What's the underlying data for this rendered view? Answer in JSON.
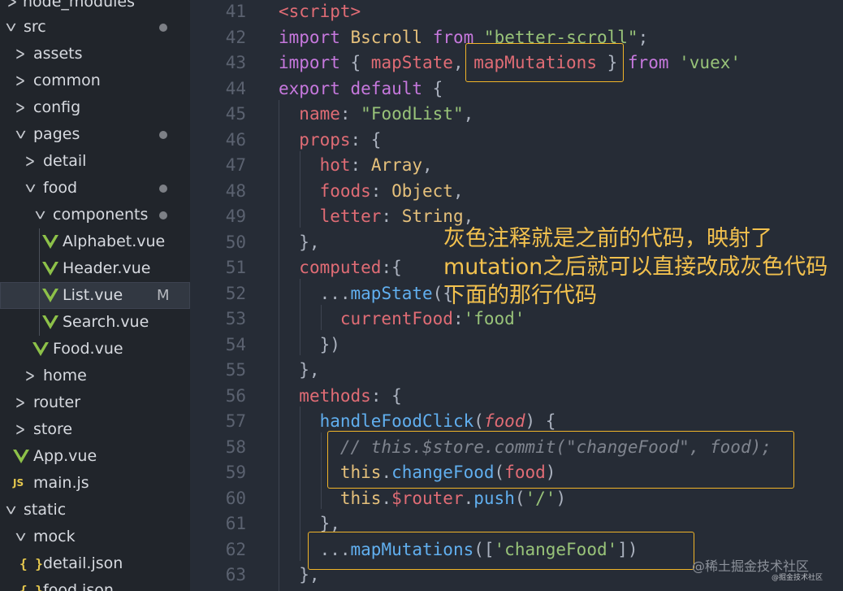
{
  "explorer": {
    "items": [
      {
        "label": "node_modules",
        "icon": "chevron-right-icon"
      },
      {
        "label": "src",
        "icon": "chevron-down-icon",
        "modified_dot": true
      },
      {
        "label": "assets",
        "icon": "chevron-right-icon"
      },
      {
        "label": "common",
        "icon": "chevron-right-icon"
      },
      {
        "label": "config",
        "icon": "chevron-right-icon"
      },
      {
        "label": "pages",
        "icon": "chevron-down-icon",
        "modified_dot": true
      },
      {
        "label": "detail",
        "icon": "chevron-right-icon"
      },
      {
        "label": "food",
        "icon": "chevron-down-icon",
        "modified_dot": true
      },
      {
        "label": "components",
        "icon": "chevron-down-icon",
        "modified_dot": true
      },
      {
        "label": "Alphabet.vue",
        "icon": "vue-icon"
      },
      {
        "label": "Header.vue",
        "icon": "vue-icon"
      },
      {
        "label": "List.vue",
        "icon": "vue-icon",
        "badge": "M",
        "selected": true
      },
      {
        "label": "Search.vue",
        "icon": "vue-icon"
      },
      {
        "label": "Food.vue",
        "icon": "vue-icon"
      },
      {
        "label": "home",
        "icon": "chevron-right-icon"
      },
      {
        "label": "router",
        "icon": "chevron-right-icon"
      },
      {
        "label": "store",
        "icon": "chevron-right-icon"
      },
      {
        "label": "App.vue",
        "icon": "vue-icon"
      },
      {
        "label": "main.js",
        "icon": "js-icon",
        "icon_text": "JS"
      },
      {
        "label": "static",
        "icon": "chevron-down-icon"
      },
      {
        "label": "mock",
        "icon": "chevron-down-icon"
      },
      {
        "label": "detail.json",
        "icon": "json-icon",
        "icon_text": "{ }"
      },
      {
        "label": "food.json",
        "icon": "json-icon",
        "icon_text": "{ }"
      }
    ]
  },
  "editor": {
    "lines": [
      {
        "n": "41",
        "tokens": [
          [
            "tag",
            "<script>"
          ]
        ]
      },
      {
        "n": "42",
        "tokens": [
          [
            "kw",
            "import"
          ],
          [
            "punc",
            " "
          ],
          [
            "id",
            "Bscroll"
          ],
          [
            "punc",
            " "
          ],
          [
            "kw",
            "from"
          ],
          [
            "punc",
            " "
          ],
          [
            "str",
            "\"better-scroll\""
          ],
          [
            "punc",
            ";"
          ]
        ]
      },
      {
        "n": "43",
        "tokens": [
          [
            "kw",
            "import"
          ],
          [
            "punc",
            " { "
          ],
          [
            "prop",
            "mapState"
          ],
          [
            "punc",
            ", "
          ],
          [
            "prop",
            "mapMutations"
          ],
          [
            "punc",
            " } "
          ],
          [
            "kw",
            "from"
          ],
          [
            "punc",
            " "
          ],
          [
            "str",
            "'vuex'"
          ]
        ]
      },
      {
        "n": "44",
        "tokens": [
          [
            "kw",
            "export"
          ],
          [
            "punc",
            " "
          ],
          [
            "kw",
            "default"
          ],
          [
            "punc",
            " {"
          ]
        ]
      },
      {
        "n": "45",
        "tokens": [
          [
            "punc",
            "  "
          ],
          [
            "prop",
            "name"
          ],
          [
            "punc",
            ": "
          ],
          [
            "str",
            "\"FoodList\""
          ],
          [
            "punc",
            ","
          ]
        ]
      },
      {
        "n": "46",
        "tokens": [
          [
            "punc",
            "  "
          ],
          [
            "prop",
            "props"
          ],
          [
            "punc",
            ": {"
          ]
        ]
      },
      {
        "n": "47",
        "tokens": [
          [
            "punc",
            "    "
          ],
          [
            "prop",
            "hot"
          ],
          [
            "punc",
            ": "
          ],
          [
            "type",
            "Array"
          ],
          [
            "punc",
            ","
          ]
        ]
      },
      {
        "n": "48",
        "tokens": [
          [
            "punc",
            "    "
          ],
          [
            "prop",
            "foods"
          ],
          [
            "punc",
            ": "
          ],
          [
            "type",
            "Object"
          ],
          [
            "punc",
            ","
          ]
        ]
      },
      {
        "n": "49",
        "tokens": [
          [
            "punc",
            "    "
          ],
          [
            "prop",
            "letter"
          ],
          [
            "punc",
            ": "
          ],
          [
            "type",
            "String"
          ],
          [
            "punc",
            ","
          ]
        ]
      },
      {
        "n": "50",
        "tokens": [
          [
            "punc",
            "  },"
          ]
        ]
      },
      {
        "n": "51",
        "tokens": [
          [
            "punc",
            "  "
          ],
          [
            "prop",
            "computed"
          ],
          [
            "punc",
            ":{"
          ]
        ]
      },
      {
        "n": "52",
        "tokens": [
          [
            "punc",
            "    ..."
          ],
          [
            "fn",
            "mapState"
          ],
          [
            "punc",
            "({"
          ]
        ]
      },
      {
        "n": "53",
        "tokens": [
          [
            "punc",
            "      "
          ],
          [
            "prop",
            "currentFood"
          ],
          [
            "punc",
            ":"
          ],
          [
            "str",
            "'food'"
          ]
        ]
      },
      {
        "n": "54",
        "tokens": [
          [
            "punc",
            "    })"
          ]
        ]
      },
      {
        "n": "55",
        "tokens": [
          [
            "punc",
            "  },"
          ]
        ]
      },
      {
        "n": "56",
        "tokens": [
          [
            "punc",
            "  "
          ],
          [
            "prop",
            "methods"
          ],
          [
            "punc",
            ": {"
          ]
        ]
      },
      {
        "n": "57",
        "tokens": [
          [
            "punc",
            "    "
          ],
          [
            "fn",
            "handleFoodClick"
          ],
          [
            "punc",
            "("
          ],
          [
            "param",
            "food"
          ],
          [
            "punc",
            ") {"
          ]
        ]
      },
      {
        "n": "58",
        "tokens": [
          [
            "punc",
            "      "
          ],
          [
            "cmt",
            "// this.$store.commit(\"changeFood\", food);"
          ]
        ]
      },
      {
        "n": "59",
        "tokens": [
          [
            "punc",
            "      "
          ],
          [
            "this",
            "this"
          ],
          [
            "punc",
            "."
          ],
          [
            "fn",
            "changeFood"
          ],
          [
            "punc",
            "("
          ],
          [
            "var",
            "food"
          ],
          [
            "punc",
            ")"
          ]
        ]
      },
      {
        "n": "60",
        "tokens": [
          [
            "punc",
            "      "
          ],
          [
            "this",
            "this"
          ],
          [
            "punc",
            "."
          ],
          [
            "var",
            "$router"
          ],
          [
            "punc",
            "."
          ],
          [
            "fn",
            "push"
          ],
          [
            "punc",
            "("
          ],
          [
            "str",
            "'/'"
          ],
          [
            "punc",
            ")"
          ]
        ]
      },
      {
        "n": "61",
        "tokens": [
          [
            "punc",
            "    },"
          ]
        ]
      },
      {
        "n": "62",
        "tokens": [
          [
            "punc",
            "    ..."
          ],
          [
            "fn",
            "mapMutations"
          ],
          [
            "punc",
            "(["
          ],
          [
            "str",
            "'changeFood'"
          ],
          [
            "punc",
            "])"
          ]
        ]
      },
      {
        "n": "63",
        "tokens": [
          [
            "punc",
            "  },"
          ]
        ]
      }
    ]
  },
  "annotation": {
    "text": "灰色注释就是之前的代码，映射了mutation之后就可以直接改成灰色代码下面的那行代码"
  },
  "watermark": {
    "text": "@稀土掘金技术社区",
    "small_text": "@掘金技术社区"
  },
  "colors": {
    "highlight_box": "#f0b429",
    "annotation": "#f2c14e",
    "editor_background": "#262c36",
    "sidebar_background": "#21252b"
  }
}
